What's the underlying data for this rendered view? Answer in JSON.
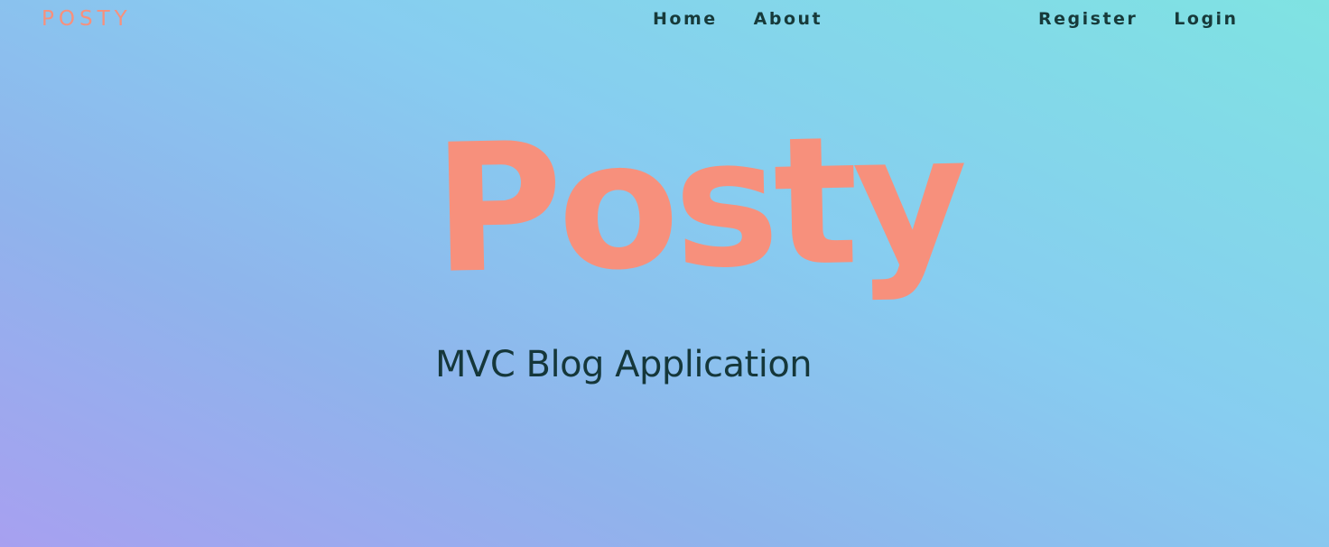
{
  "header": {
    "brand": "POSTY",
    "nav_center": [
      {
        "label": "Home"
      },
      {
        "label": "About"
      }
    ],
    "nav_right": [
      {
        "label": "Register"
      },
      {
        "label": "Login"
      }
    ]
  },
  "hero": {
    "title": "Posty",
    "subtitle": "MVC Blog Application"
  },
  "colors": {
    "accent": "#f7907c",
    "text_dark": "#173a3a",
    "gradient_start": "#a7a0f0",
    "gradient_end": "#7fe3e2"
  }
}
